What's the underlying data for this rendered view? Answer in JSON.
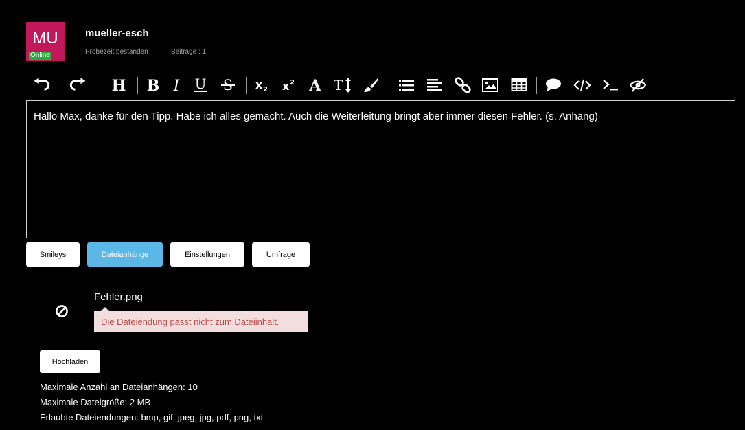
{
  "user": {
    "initials": "MU",
    "status": "Online",
    "name": "mueller-esch",
    "rank": "Probezeit bestanden",
    "posts": "Beiträge : 1"
  },
  "toolbar": {
    "icons": [
      "undo-icon",
      "redo-icon",
      "heading-icon",
      "bold-icon",
      "italic-icon",
      "underline-icon",
      "strikethrough-icon",
      "subscript-icon",
      "superscript-icon",
      "font-icon",
      "font-size-icon",
      "color-brush-icon",
      "list-icon",
      "align-icon",
      "link-icon",
      "image-icon",
      "table-icon",
      "quote-icon",
      "code-icon",
      "terminal-icon",
      "spoiler-icon"
    ]
  },
  "editor": {
    "text": "Hallo Max, danke für den Tipp. Habe ich alles gemacht. Auch die Weiterleitung bringt aber immer diesen Fehler. (s. Anhang)"
  },
  "tabs": [
    {
      "label": "Smileys",
      "active": false
    },
    {
      "label": "Dateianhänge",
      "active": true
    },
    {
      "label": "Einstellungen",
      "active": false
    },
    {
      "label": "Umfrage",
      "active": false
    }
  ],
  "attachment": {
    "filename": "Fehler.png",
    "error": "Die Dateiendung passt nicht zum Dateiinhalt.",
    "icon": "forbidden-icon"
  },
  "upload_label": "Hochladen",
  "limits": {
    "max_count": "Maximale Anzahl an Dateianhängen: 10",
    "max_size": "Maximale Dateigröße: 2 MB",
    "allowed": "Erlaubte Dateiendungen: bmp, gif, jpeg, jpg, pdf, png, txt"
  },
  "colors": {
    "avatar": "#c2185b",
    "online": "#2eaa3a",
    "active_tab": "#5bb8e6",
    "error_bg": "#f2dede",
    "error_text": "#b94a48"
  }
}
